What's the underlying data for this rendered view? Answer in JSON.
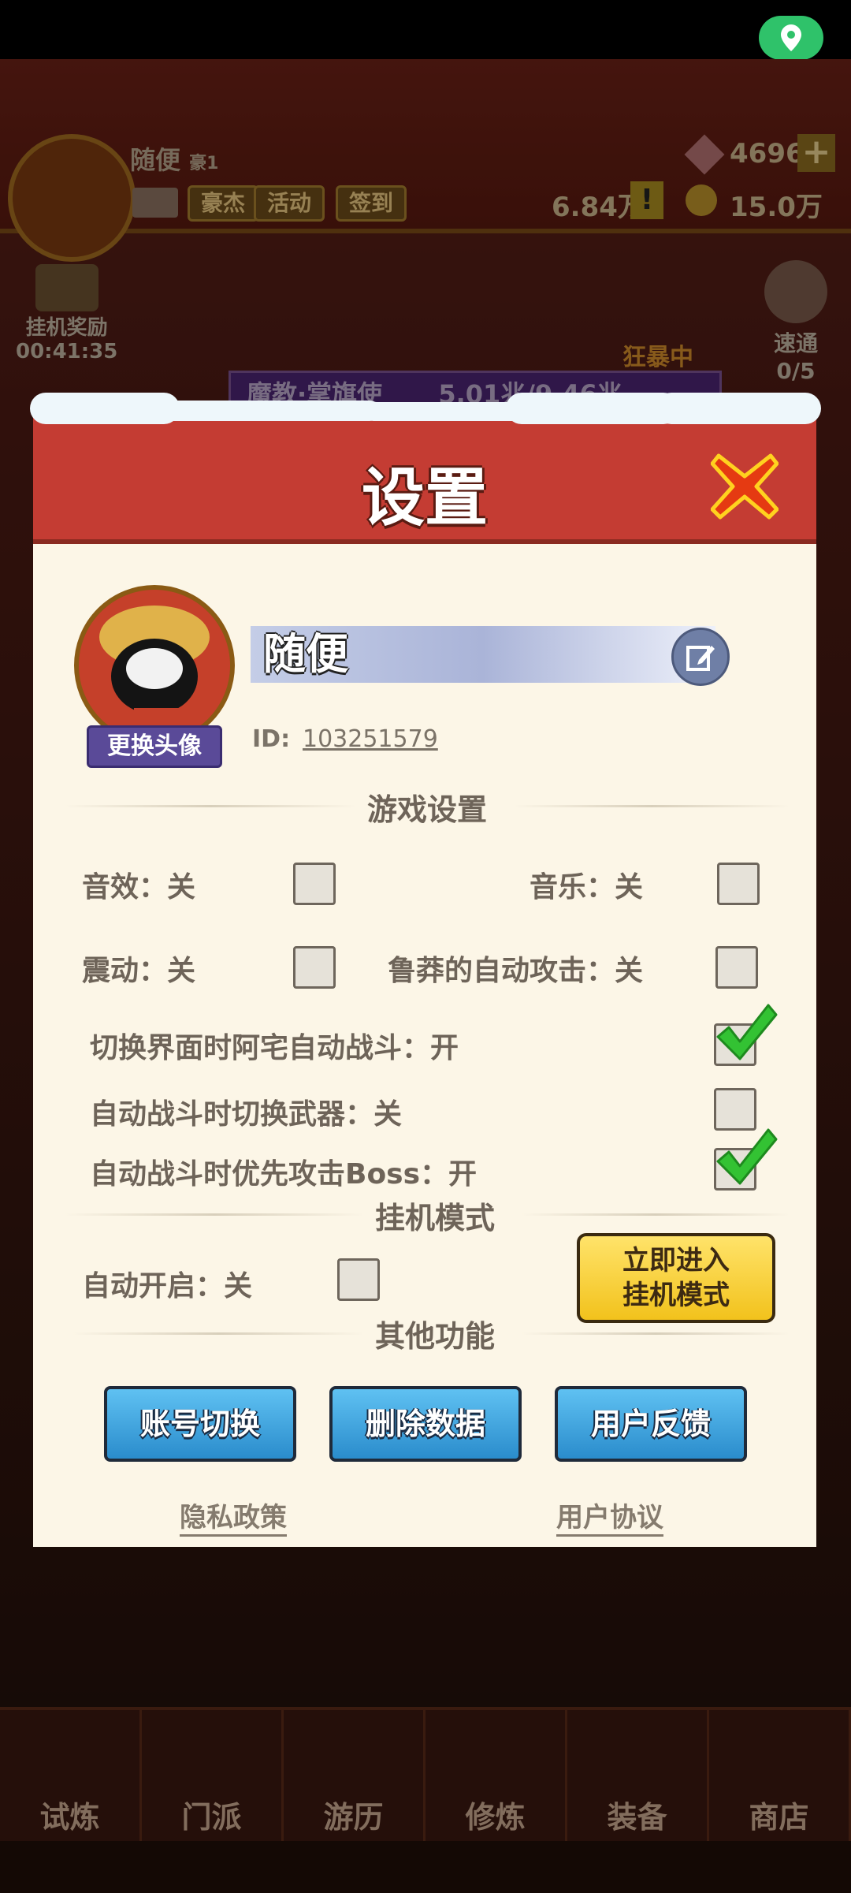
{
  "status_bar": {
    "location_icon": "location-pin-icon"
  },
  "background": {
    "player_name": "随便",
    "player_title": "豪1",
    "buttons": [
      "豪杰",
      "活动",
      "签到"
    ],
    "gems": "4696",
    "currency_a": "6.84万",
    "currency_b": "15.0万",
    "idle_reward_label": "挂机奖励",
    "idle_reward_timer": "00:41:35",
    "speed_label": "速通",
    "speed_count": "0/5",
    "boss_name": "魔教·掌旗使",
    "boss_hp": "5.01兆/9.46兆",
    "rage_label": "狂暴中",
    "nav": [
      "试炼",
      "门派",
      "游历",
      "修炼",
      "装备",
      "商店"
    ]
  },
  "dialog": {
    "title": "设置",
    "profile": {
      "change_avatar": "更换头像",
      "name": "随便",
      "id_label": "ID:",
      "id_value": "103251579"
    },
    "game_settings": {
      "title": "游戏设置",
      "options": [
        {
          "label": "音效：关",
          "checked": false
        },
        {
          "label": "音乐：关",
          "checked": false
        },
        {
          "label": "震动：关",
          "checked": false
        },
        {
          "label": "鲁莽的自动攻击：关",
          "checked": false
        },
        {
          "label": "切换界面时阿宅自动战斗：开",
          "checked": true
        },
        {
          "label": "自动战斗时切换武器：关",
          "checked": false
        },
        {
          "label": "自动战斗时优先攻击Boss：开",
          "checked": true
        }
      ]
    },
    "idle_mode": {
      "title": "挂机模式",
      "auto_start": "自动开启：关",
      "enter_button_line1": "立即进入",
      "enter_button_line2": "挂机模式"
    },
    "other": {
      "title": "其他功能",
      "buttons": [
        "账号切换",
        "删除数据",
        "用户反馈"
      ],
      "links": [
        "隐私政策",
        "用户协议"
      ]
    }
  }
}
